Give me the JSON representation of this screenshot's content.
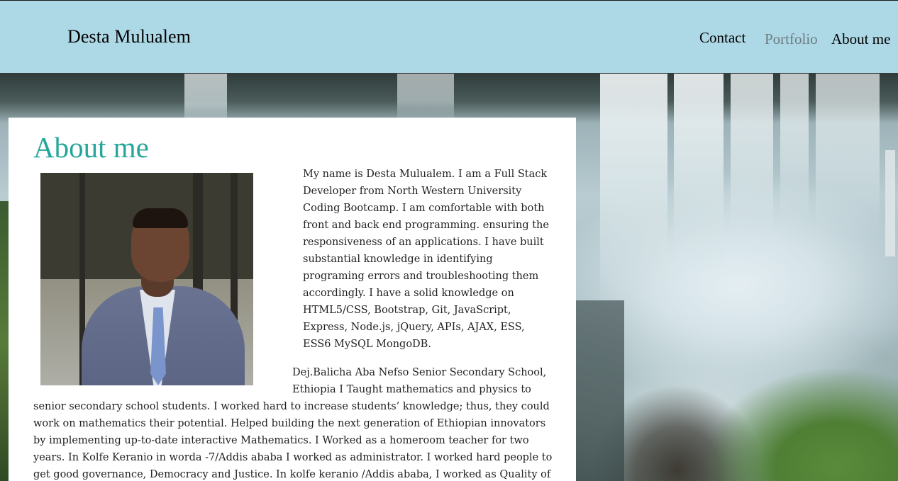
{
  "header": {
    "brand": "Desta Mulualem",
    "nav": {
      "contact": "Contact",
      "portfolio": "Portfolio",
      "about": "About me"
    }
  },
  "about": {
    "title": "About me",
    "intro": "My name is Desta Mulualem. I am a Full Stack Developer from North Western University Coding Bootcamp. I am comfortable with both front and back end programming. ensuring the responsiveness of an applications. I have built substantial knowledge in identifying programing errors and troubleshooting them accordingly. I have a solid knowledge on HTML5/CSS, Bootstrap, Git, JavaScript, Express, Node.js, jQuery, APIs, AJAX, ESS, ESS6 MySQL MongoDB.",
    "history_top": "Dej.Balicha Aba Nefso Senior Secondary School, Ethiopia I Taught mathematics and physics to",
    "history_rest": "senior secondary school students. I worked hard to increase students’ knowledge; thus, they could work on mathematics their potential. Helped building the next generation of Ethiopian innovators by implementing up-to-date interactive Mathematics. I Worked as a homeroom teacher for two years. In Kolfe Keranio in worda -7/Addis ababa I worked as administrator. I worked hard people to get good governance, Democracy and Justice. In kolfe keranio /Addis ababa, I worked as Quality of Education"
  },
  "colors": {
    "navbar_bg": "#add8e6",
    "title_teal": "#26a69a",
    "portfolio_link": "#6e7c80"
  }
}
